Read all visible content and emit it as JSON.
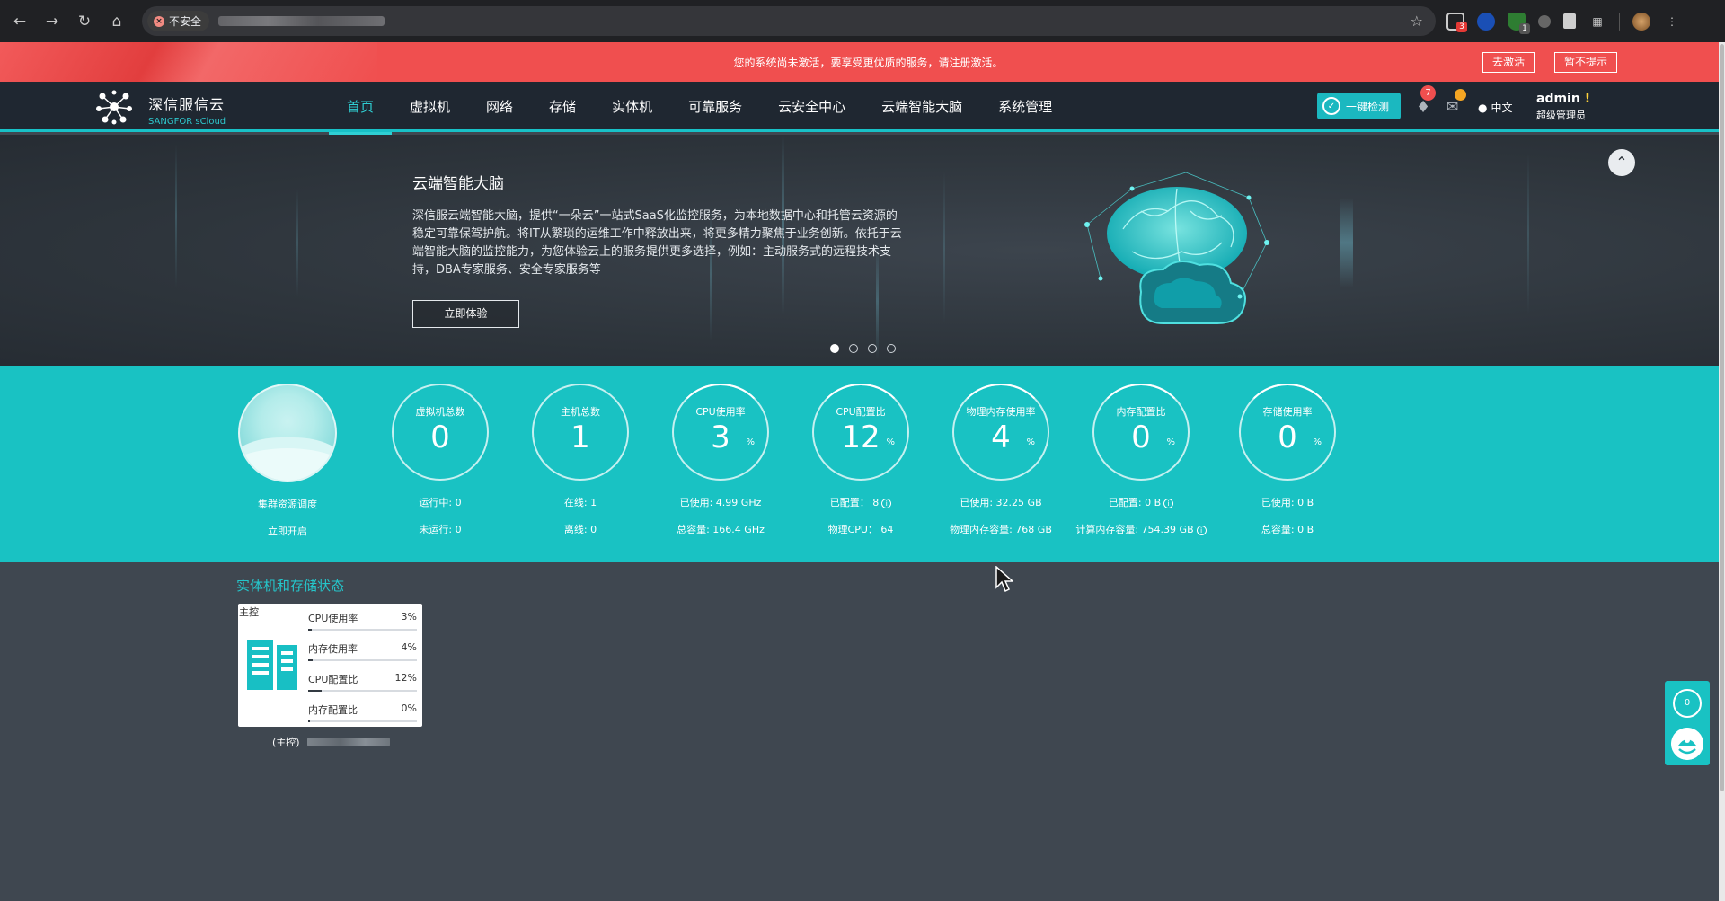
{
  "browser": {
    "security_label": "不安全"
  },
  "banner": {
    "message": "您的系统尚未激活，要享受更优质的服务，请注册激活。",
    "activate_label": "去激活",
    "dismiss_label": "暂不提示"
  },
  "brand": {
    "name": "深信服信云",
    "sub": "SANGFOR sCloud"
  },
  "menu": [
    {
      "label": "首页",
      "active": true
    },
    {
      "label": "虚拟机"
    },
    {
      "label": "网络"
    },
    {
      "label": "存储"
    },
    {
      "label": "实体机"
    },
    {
      "label": "可靠服务"
    },
    {
      "label": "云安全中心"
    },
    {
      "label": "云端智能大脑"
    },
    {
      "label": "系统管理"
    }
  ],
  "header": {
    "check_label": "一键检测",
    "bell_count": "7",
    "lang_label": "中文",
    "user_name": "admin",
    "user_warn": "!",
    "user_role": "超级管理员"
  },
  "hero": {
    "title": "云端智能大脑",
    "description": "深信服云端智能大脑，提供“一朵云”一站式SaaS化监控服务，为本地数据中心和托管云资源的稳定可靠保驾护航。将IT从繁琐的运维工作中释放出来，将更多精力聚焦于业务创新。依托于云端智能大脑的监控能力，为您体验云上的服务提供更多选择，例如：主动服务式的远程技术支持，DBA专家服务、安全专家服务等",
    "button_label": "立即体验",
    "slide_count": 4,
    "active_slide": 0
  },
  "stats": {
    "cluster": {
      "label": "集群资源调度",
      "action": "立即开启"
    },
    "items": [
      {
        "label": "虚拟机总数",
        "value": "0",
        "unit": "",
        "line1": "运行中: 0",
        "line2": "未运行: 0"
      },
      {
        "label": "主机总数",
        "value": "1",
        "unit": "",
        "line1": "在线: 1",
        "line2": "离线: 0"
      },
      {
        "label": "CPU使用率",
        "value": "3",
        "unit": "%",
        "line1": "已使用: 4.99 GHz",
        "line2": "总容量: 166.4 GHz"
      },
      {
        "label": "CPU配置比",
        "value": "12",
        "unit": "%",
        "line1": "已配置： 8",
        "line2": "物理CPU： 64"
      },
      {
        "label": "物理内存使用率",
        "value": "4",
        "unit": "%",
        "line1": "已使用: 32.25 GB",
        "line2": "物理内存容量: 768 GB"
      },
      {
        "label": "内存配置比",
        "value": "0",
        "unit": "%",
        "line1": "已配置: 0 B",
        "line2": "计算内存容量: 754.39 GB"
      },
      {
        "label": "存储使用率",
        "value": "0",
        "unit": "%",
        "line1": "已使用: 0 B",
        "line2": "总容量: 0 B"
      }
    ]
  },
  "hosts": {
    "section_title": "实体机和存储状态",
    "card": {
      "tag": "主控",
      "metrics": [
        {
          "label": "CPU使用率",
          "value": "3%",
          "fraction": 0.03
        },
        {
          "label": "内存使用率",
          "value": "4%",
          "fraction": 0.04
        },
        {
          "label": "CPU配置比",
          "value": "12%",
          "fraction": 0.12
        },
        {
          "label": "内存配置比",
          "value": "0%",
          "fraction": 0.0
        }
      ],
      "name_prefix": "(主控)"
    }
  },
  "float_widget": {
    "count": "0"
  },
  "colors": {
    "accent": "#19c2c3",
    "banner": "#f04f4f",
    "nav_bg": "#1f2731"
  }
}
